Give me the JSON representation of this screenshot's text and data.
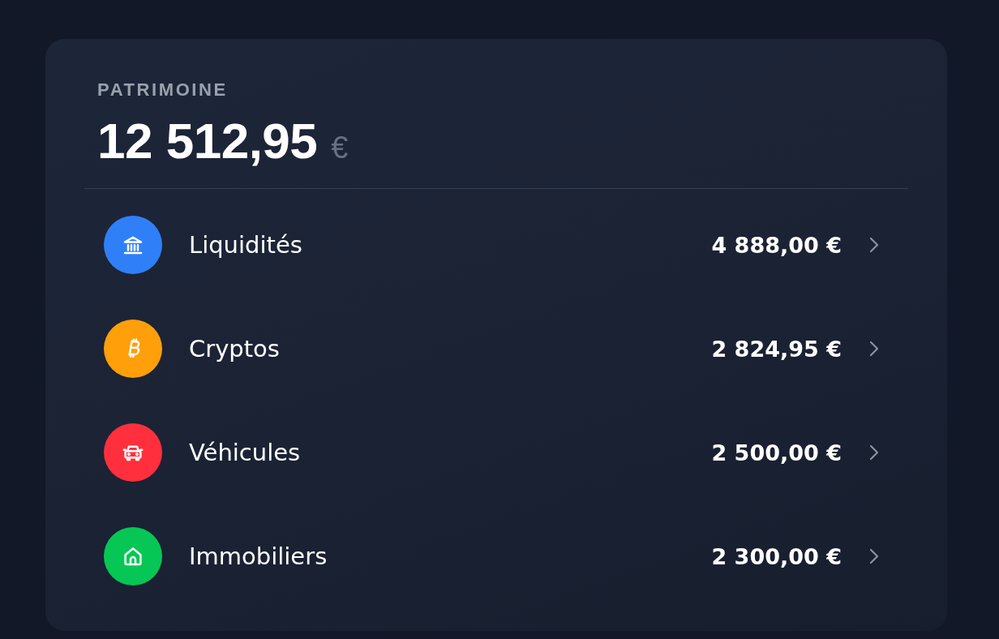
{
  "header": {
    "label": "PATRIMOINE",
    "total": "12 512,95",
    "currency": "€"
  },
  "assets": [
    {
      "kind": "bank",
      "color": "#2f80f8",
      "name": "Liquidités",
      "amount": "4 888,00 €"
    },
    {
      "kind": "bitcoin",
      "color": "#ff9f0a",
      "name": "Cryptos",
      "amount": "2 824,95 €"
    },
    {
      "kind": "car",
      "color": "#ff2f3e",
      "name": "Véhicules",
      "amount": "2 500,00 €"
    },
    {
      "kind": "house",
      "color": "#06c755",
      "name": "Immobiliers",
      "amount": "2 300,00 €"
    }
  ]
}
